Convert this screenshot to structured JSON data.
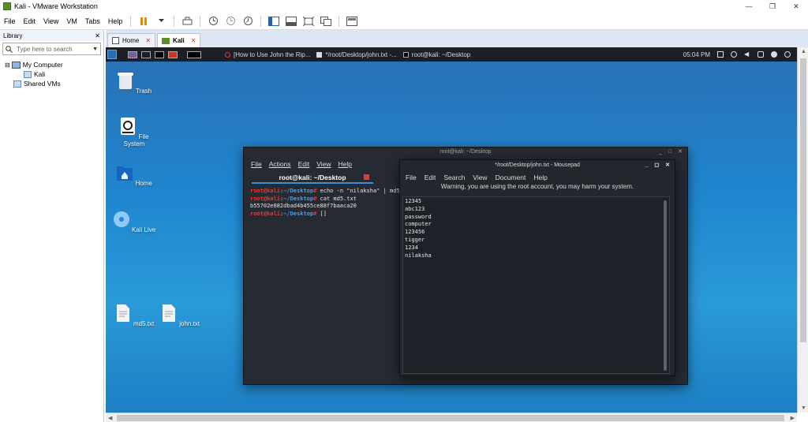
{
  "window": {
    "title": "Kali - VMware Workstation",
    "minimize": "—",
    "maximize": "❐",
    "close": "✕"
  },
  "menu": [
    "File",
    "Edit",
    "View",
    "VM",
    "Tabs",
    "Help"
  ],
  "library": {
    "title": "Library",
    "close": "✕",
    "search_placeholder": "Type here to search",
    "tree": {
      "root": "My Computer",
      "child": "Kali",
      "shared": "Shared VMs"
    }
  },
  "tabs": [
    {
      "label": "Home",
      "close": "✕"
    },
    {
      "label": "Kali",
      "close": "✕"
    }
  ],
  "guest": {
    "taskbar": {
      "tasks": [
        "[How to Use John the Rip...",
        "*/root/Desktop/john.txt -...",
        "root@kali: ~/Desktop"
      ],
      "time": "05:04 PM"
    },
    "desktop_icons": [
      "Trash",
      "File System",
      "Home",
      "Kali Live",
      "md5.txt",
      "john.txt"
    ],
    "terminal": {
      "title": "root@kali: ~/Desktop",
      "menu": [
        "File",
        "Actions",
        "Edit",
        "View",
        "Help"
      ],
      "tab_label": "root@kali: ~/Desktop",
      "prompt_user": "root@kali",
      "prompt_sep": ":",
      "prompt_path": "~/Desktop",
      "prompt_end": "#",
      "cmd1": " echo -n \"nilaksha\" | md5",
      "cmd2": " cat md5.txt",
      "output": "b55702e082dbad4b455ce88f7baaca20",
      "cmd3": " []"
    },
    "mousepad": {
      "title": "*/root/Desktop/john.txt - Mousepad",
      "menu": [
        "File",
        "Edit",
        "Search",
        "View",
        "Document",
        "Help"
      ],
      "warning": "Warning, you are using the root account, you may harm your system.",
      "lines": [
        "12345",
        "abc123",
        "password",
        "computer",
        "123456",
        "tigger",
        "1234",
        "nilaksha"
      ]
    }
  },
  "colors": {
    "accent": "#3b8fd9",
    "prompt_red": "#e53935",
    "prompt_blue": "#4d9de0",
    "desktop": "#1f86cf"
  }
}
